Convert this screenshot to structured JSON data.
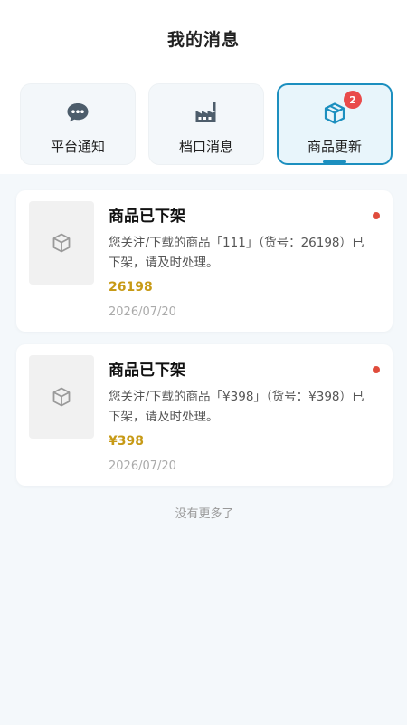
{
  "header": {
    "title": "我的消息"
  },
  "tabs": [
    {
      "label": "平台通知",
      "icon": "chat-bubble-icon",
      "active": false
    },
    {
      "label": "档口消息",
      "icon": "factory-icon",
      "active": false
    },
    {
      "label": "商品更新",
      "icon": "package-icon",
      "active": true,
      "badge": "2"
    }
  ],
  "messages": [
    {
      "title": "商品已下架",
      "description": "您关注/下载的商品「111」（货号：26198）已下架，请及时处理。",
      "price": "26198",
      "date": "2026/07/20",
      "unread": true
    },
    {
      "title": "商品已下架",
      "description": "您关注/下载的商品「¥398」（货号：¥398）已下架，请及时处理。",
      "price": "¥398",
      "date": "2026/07/20",
      "unread": true
    }
  ],
  "footer": {
    "no_more": "没有更多了"
  },
  "colors": {
    "accent": "#1c8fbf",
    "badge": "#e94b4b",
    "price": "#c79a16",
    "unread": "#e04c3c"
  }
}
